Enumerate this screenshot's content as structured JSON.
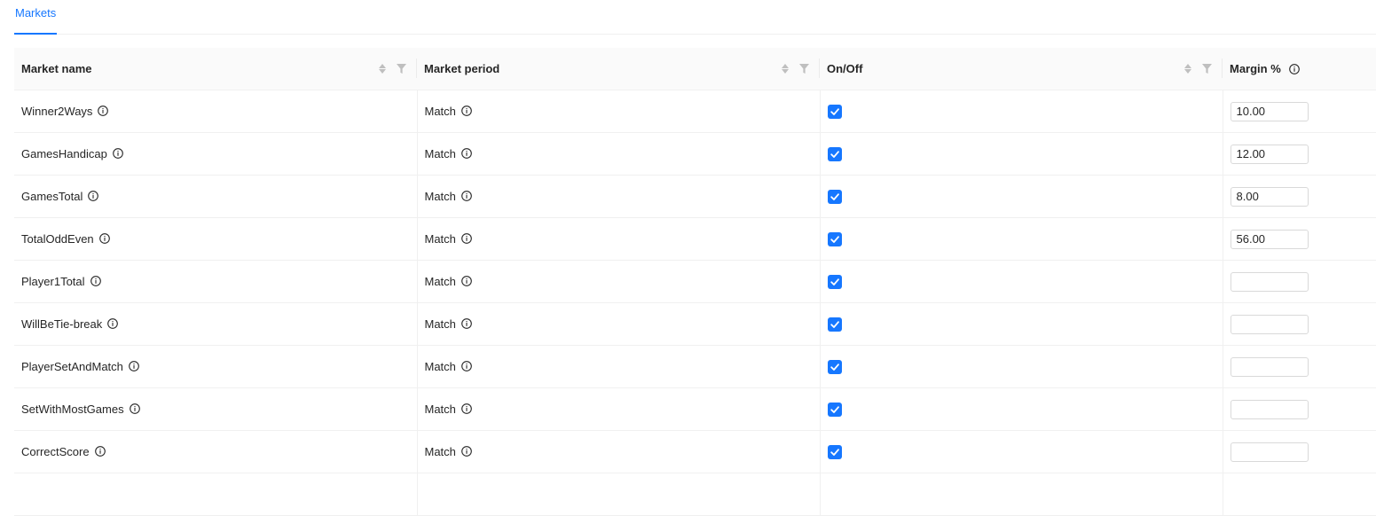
{
  "tabs": [
    {
      "label": "Markets",
      "active": true
    }
  ],
  "table": {
    "columns": {
      "name": "Market name",
      "period": "Market period",
      "onoff": "On/Off",
      "margin": "Margin %"
    },
    "rows": [
      {
        "name": "Winner2Ways",
        "period": "Match",
        "enabled": true,
        "margin": "10.00"
      },
      {
        "name": "GamesHandicap",
        "period": "Match",
        "enabled": true,
        "margin": "12.00"
      },
      {
        "name": "GamesTotal",
        "period": "Match",
        "enabled": true,
        "margin": "8.00"
      },
      {
        "name": "TotalOddEven",
        "period": "Match",
        "enabled": true,
        "margin": "56.00"
      },
      {
        "name": "Player1Total",
        "period": "Match",
        "enabled": true,
        "margin": ""
      },
      {
        "name": "WillBeTie-break",
        "period": "Match",
        "enabled": true,
        "margin": ""
      },
      {
        "name": "PlayerSetAndMatch",
        "period": "Match",
        "enabled": true,
        "margin": ""
      },
      {
        "name": "SetWithMostGames",
        "period": "Match",
        "enabled": true,
        "margin": ""
      },
      {
        "name": "CorrectScore",
        "period": "Match",
        "enabled": true,
        "margin": ""
      }
    ]
  },
  "colors": {
    "accent": "#1677ff",
    "header_bg": "#fafafa",
    "border": "#f0f0f0"
  },
  "icons": {
    "info": "info-circle-icon",
    "sort": "sort-icon",
    "filter": "filter-icon",
    "check": "checkmark-icon"
  }
}
